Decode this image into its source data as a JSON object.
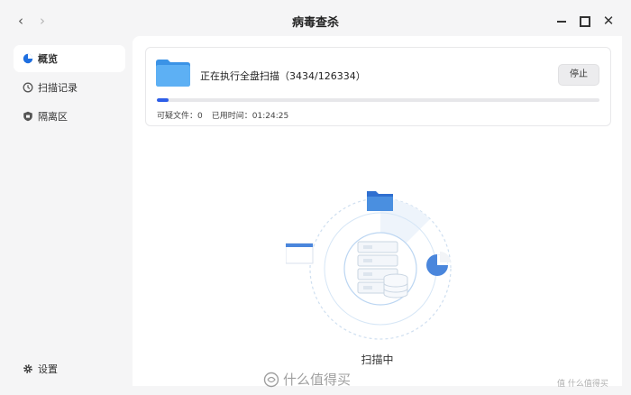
{
  "window": {
    "title": "病毒查杀",
    "back_glyph": "‹",
    "forward_glyph": "›",
    "close_glyph": "✕"
  },
  "sidebar": {
    "items": [
      {
        "label": "概览",
        "icon": "overview-icon",
        "active": true
      },
      {
        "label": "扫描记录",
        "icon": "scan-record-icon",
        "active": false
      },
      {
        "label": "隔离区",
        "icon": "quarantine-icon",
        "active": false
      }
    ],
    "settings_label": "设置"
  },
  "scan": {
    "status_line": "正在执行全盘扫描（3434/126334）",
    "stop_label": "停止",
    "progress": 0.027,
    "suspicious_label": "可疑文件：",
    "suspicious_count": "0",
    "elapsed_label": "已用时间：",
    "elapsed_value": "01:24:25",
    "state_text": "扫描中"
  },
  "watermark": {
    "text": "什么值得买",
    "small": "值 什么值得买"
  },
  "colors": {
    "accent": "#2d5ee8",
    "folder": "#4aa3f0",
    "ring": "#bcd6f2"
  }
}
